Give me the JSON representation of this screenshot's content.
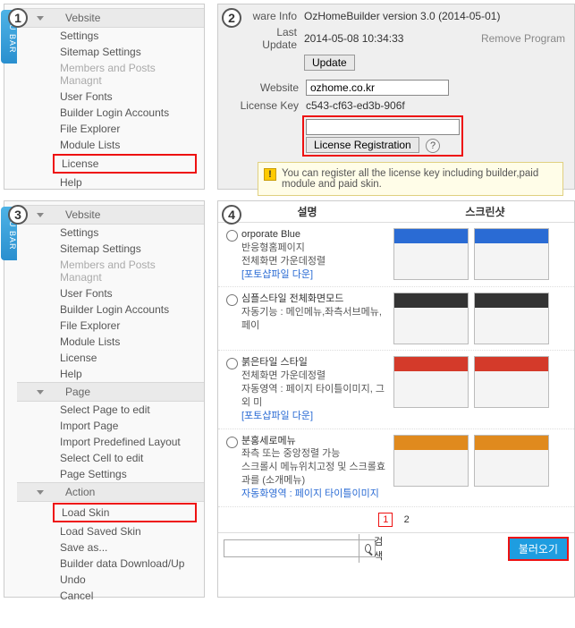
{
  "badges": [
    "1",
    "2",
    "3",
    "4"
  ],
  "menubar_label": "U BAR",
  "panel1": {
    "header": "Vebsite",
    "items": [
      "Settings",
      "Sitemap Settings",
      "Members and Posts Managnt",
      "User Fonts",
      "Builder Login Accounts",
      "File Explorer",
      "Module Lists",
      "License",
      "Help"
    ]
  },
  "panel2": {
    "sw_label": "ware Info",
    "sw_value": "OzHomeBuilder version 3.0 (2014-05-01)",
    "last_label": "Last Update",
    "last_value": "2014-05-08 10:34:33",
    "update_btn": "Update",
    "remove": "Remove Program",
    "website_label": "Website",
    "website_value": "ozhome.co.kr",
    "key_label": "License Key",
    "key_value": "c543-cf63-ed3b-906f",
    "reg_btn": "License Registration",
    "warn": "You can register all the license key including builder,paid module and paid skin."
  },
  "panel3": {
    "sections": [
      {
        "header": "Vebsite",
        "items": [
          "Settings",
          "Sitemap Settings",
          "Members and Posts Managnt",
          "User Fonts",
          "Builder Login Accounts",
          "File Explorer",
          "Module Lists",
          "License",
          "Help"
        ]
      },
      {
        "header": "Page",
        "items": [
          "Select Page to edit",
          "Import Page",
          "Import Predefined Layout",
          "Select Cell to edit",
          "Page Settings"
        ]
      },
      {
        "header": "Action",
        "items": [
          "Load Skin",
          "Load Saved Skin",
          "Save as...",
          "Builder data Download/Up",
          "Undo",
          "Cancel"
        ]
      }
    ]
  },
  "panel4": {
    "col_desc": "설명",
    "col_shot": "스크린샷",
    "skins": [
      {
        "title": "orporate Blue",
        "line2": "반응형홈페이지",
        "line3": "전체화면 가운데정렬",
        "link": "[포토샵파일 다운]",
        "color": "#2a6bd4"
      },
      {
        "title": "심플스타일 전체화면모드",
        "line2": "자동기능 : 메인메뉴,좌측서브메뉴, 페이",
        "line3": "",
        "link": "",
        "color": "#333333"
      },
      {
        "title": "붉은타일 스타일",
        "line2": "전체화면 가운데정렬",
        "line3": "자동영역 : 페이지 타이틀이미지, 그외 미",
        "link": "[포토샵파일 다운]",
        "color": "#d43a2a"
      },
      {
        "title": "분홍세로메뉴",
        "line2": "좌측 또는 중앙정렬 가능",
        "line3": "스크롤시 메뉴위치고정 및 스크롤효과를 (소개메뉴)",
        "link": "자동화영역 : 페이지 타이틀이미지",
        "color": "#e08a1e"
      }
    ],
    "pages": [
      "1",
      "2"
    ],
    "search_placeholder": "",
    "search_btn": "검색",
    "load_btn": "불러오기"
  }
}
